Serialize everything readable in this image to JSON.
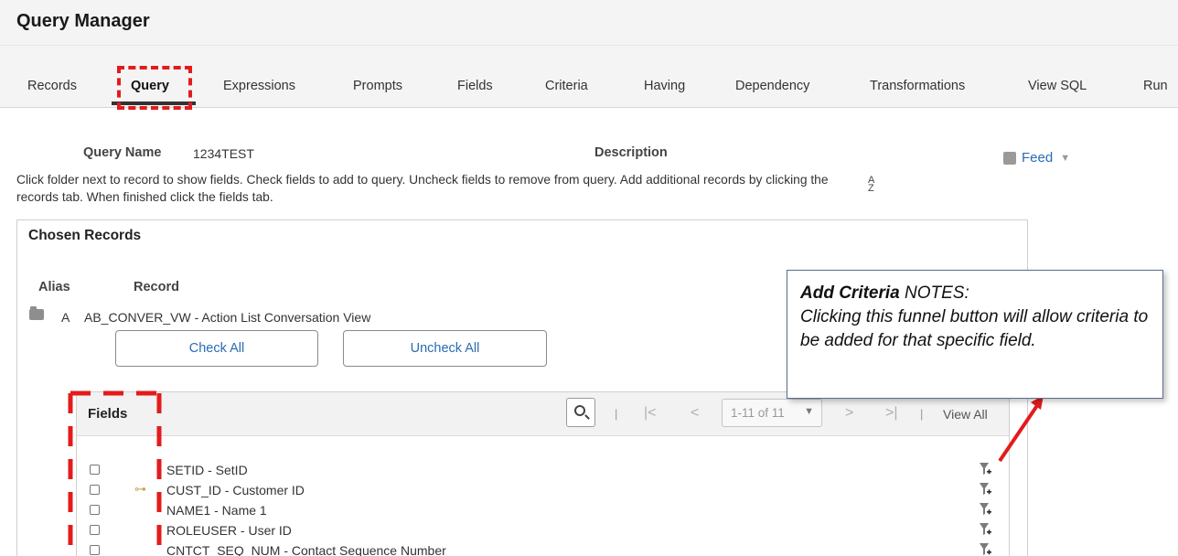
{
  "header": {
    "title": "Query Manager"
  },
  "tabs": [
    {
      "label": "Records"
    },
    {
      "label": "Query"
    },
    {
      "label": "Expressions"
    },
    {
      "label": "Prompts"
    },
    {
      "label": "Fields"
    },
    {
      "label": "Criteria"
    },
    {
      "label": "Having"
    },
    {
      "label": "Dependency"
    },
    {
      "label": "Transformations"
    },
    {
      "label": "View SQL"
    },
    {
      "label": "Run"
    }
  ],
  "active_tab": "Query",
  "query": {
    "name_label": "Query Name",
    "name_value": "1234TEST",
    "description_label": "Description",
    "instructions": "Click folder next to record to show fields. Check fields to add to query. Uncheck fields to remove from query. Add additional records by clicking the records tab. When finished click the fields tab.",
    "feed_label": "Feed"
  },
  "chosen_records": {
    "title": "Chosen Records",
    "alias_header": "Alias",
    "record_header": "Record",
    "record": {
      "alias": "A",
      "name": "AB_CONVER_VW - Action List Conversation View"
    },
    "check_all": "Check All",
    "uncheck_all": "Uncheck All"
  },
  "fields_grid": {
    "title": "Fields",
    "nav_sep": "|",
    "pagination": "1-11 of 11",
    "view_all": "View All",
    "rows": [
      {
        "name": "SETID - SetID",
        "key": false
      },
      {
        "name": "CUST_ID - Customer ID",
        "key": true
      },
      {
        "name": "NAME1 - Name 1",
        "key": false
      },
      {
        "name": "ROLEUSER - User ID",
        "key": false
      },
      {
        "name": "CNTCT_SEQ_NUM - Contact Sequence Number",
        "key": false
      }
    ]
  },
  "annotation": {
    "title_bold": "Add Criteria",
    "title_rest": " NOTES:",
    "body": "Clicking this funnel button will allow criteria to be added for that specific field."
  },
  "colors": {
    "highlight": "#e31b1b",
    "link": "#2a6cb4",
    "header_bg": "#f4f4f4"
  },
  "icons": [
    "folder-icon",
    "key-icon",
    "search-icon",
    "first-page-icon",
    "prev-page-icon",
    "next-page-icon",
    "last-page-icon",
    "funnel-add-icon",
    "feed-icon",
    "sort-icon"
  ]
}
